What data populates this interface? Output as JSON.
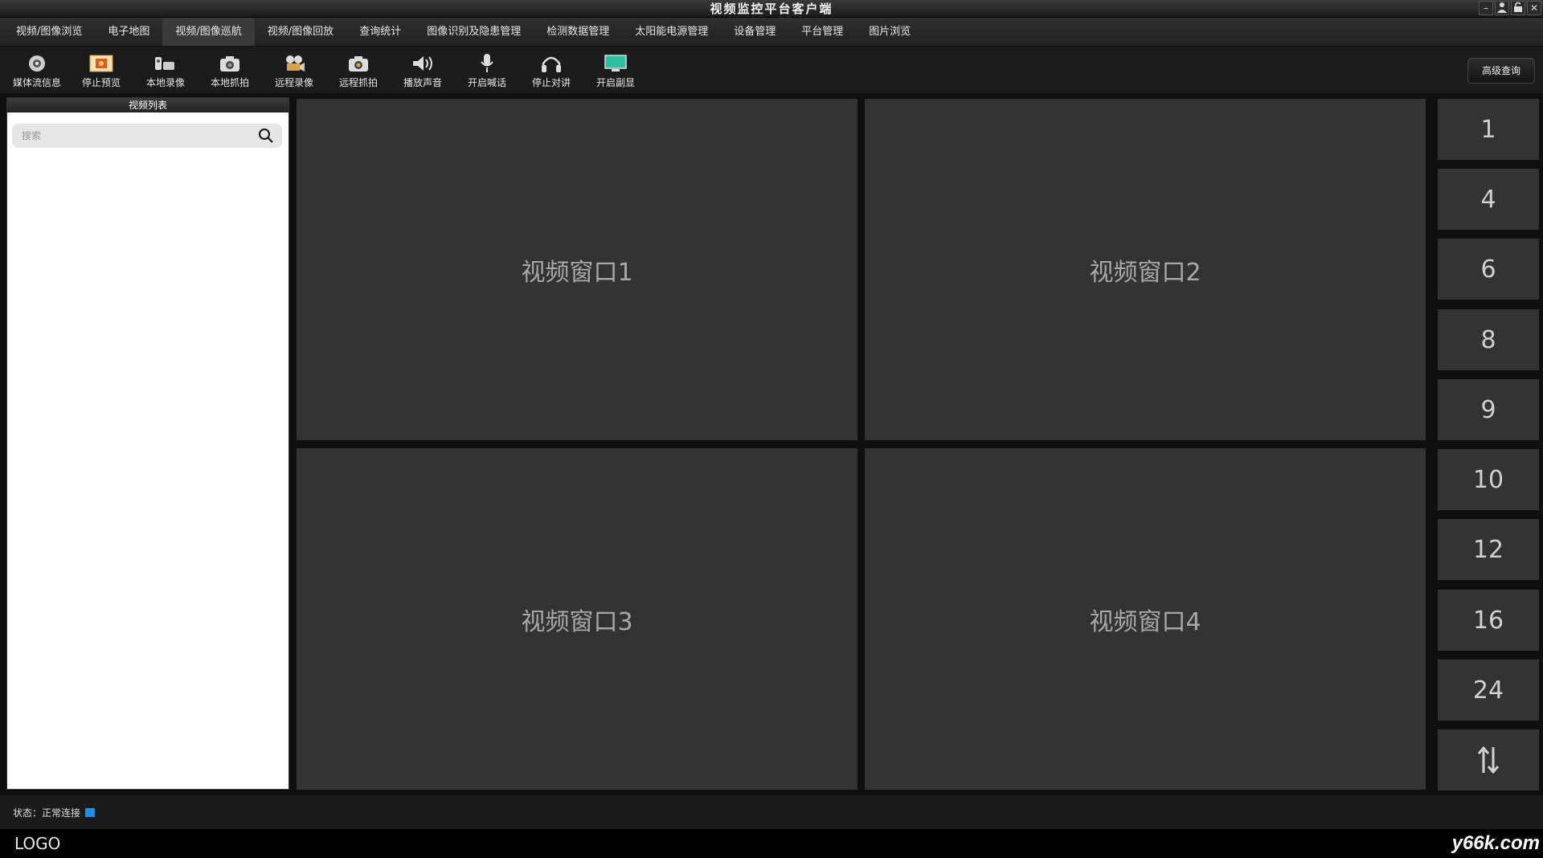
{
  "window": {
    "title": "视频监控平台客户端"
  },
  "menu": [
    {
      "label": "视频/图像浏览"
    },
    {
      "label": "电子地图"
    },
    {
      "label": "视频/图像巡航",
      "active": true
    },
    {
      "label": "视频/图像回放"
    },
    {
      "label": "查询统计"
    },
    {
      "label": "图像识别及隐患管理"
    },
    {
      "label": "检测数据管理"
    },
    {
      "label": "太阳能电源管理"
    },
    {
      "label": "设备管理"
    },
    {
      "label": "平台管理"
    },
    {
      "label": "图片浏览"
    }
  ],
  "toolbar": {
    "items": [
      {
        "label": "媒体流信息",
        "icon": "eye-icon"
      },
      {
        "label": "停止预览",
        "icon": "image-icon"
      },
      {
        "label": "本地录像",
        "icon": "camcorder-icon"
      },
      {
        "label": "本地抓拍",
        "icon": "camera-icon"
      },
      {
        "label": "远程录像",
        "icon": "film-camera-icon"
      },
      {
        "label": "远程抓拍",
        "icon": "camera-icon"
      },
      {
        "label": "播放声音",
        "icon": "speaker-icon"
      },
      {
        "label": "开启喊话",
        "icon": "microphone-icon"
      },
      {
        "label": "停止对讲",
        "icon": "headphones-icon"
      },
      {
        "label": "开启副显",
        "icon": "monitor-icon"
      }
    ],
    "advanced_query": "高级查询"
  },
  "left_panel": {
    "title": "视频列表",
    "search_placeholder": "搜索"
  },
  "video_windows": [
    "视频窗口1",
    "视频窗口2",
    "视频窗口3",
    "视频窗口4"
  ],
  "layout_buttons": [
    "1",
    "4",
    "6",
    "8",
    "9",
    "10",
    "12",
    "16",
    "24"
  ],
  "status": {
    "text": "状态：正常连接",
    "color": "#1e8fe6"
  },
  "footer": {
    "logo": "LOGO",
    "watermark": "y66k.com"
  }
}
